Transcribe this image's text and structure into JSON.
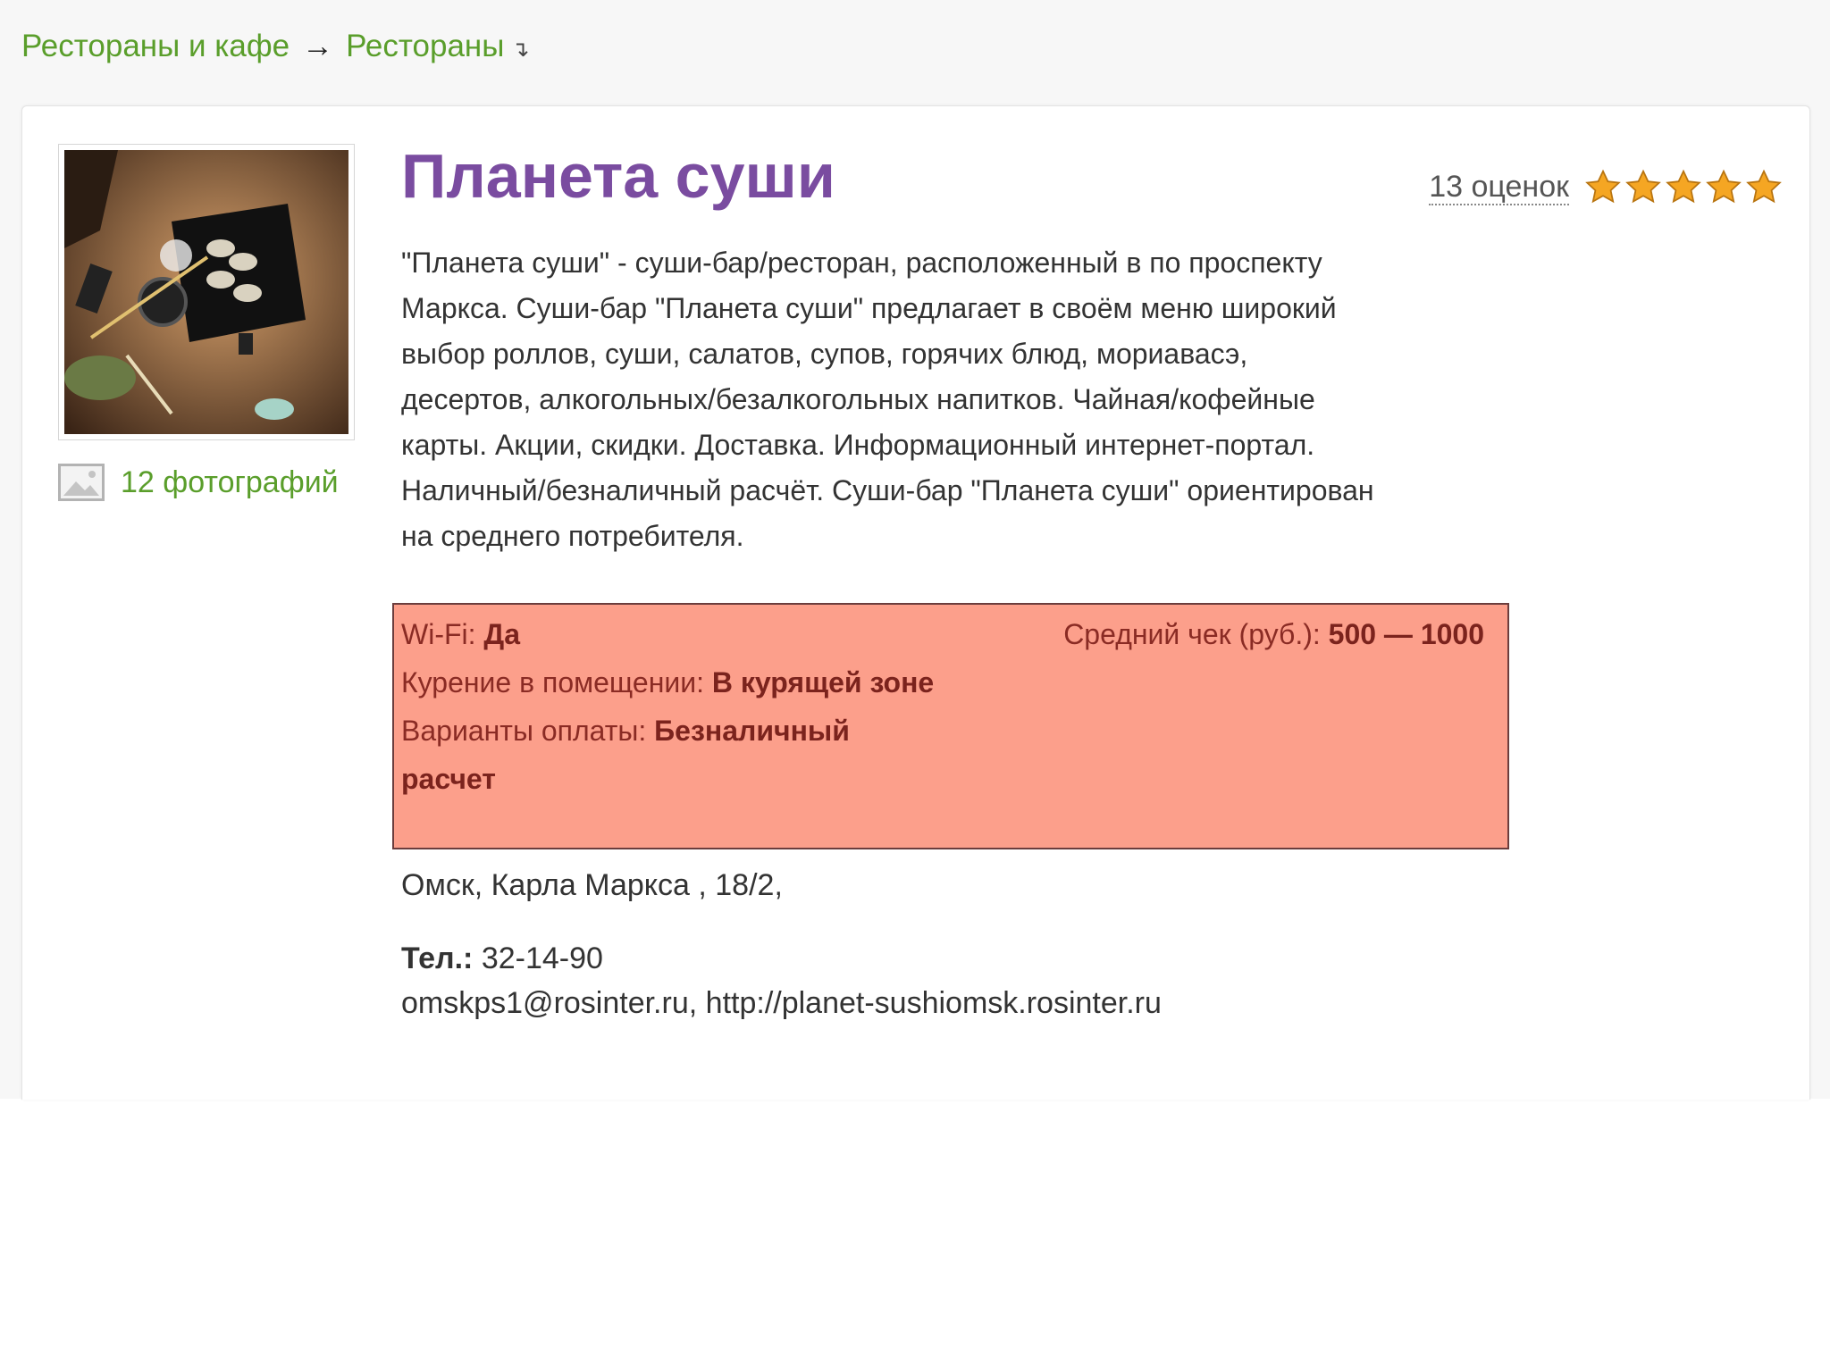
{
  "breadcrumb": {
    "items": [
      "Рестораны и кафе",
      "Рестораны"
    ],
    "separator": "→",
    "dropdown_glyph": "↴"
  },
  "restaurant": {
    "name": "Планета суши",
    "photo_count_label": "12 фотографий",
    "rating_count_label": "13 оценок",
    "stars": 5,
    "description": "\"Планета суши\" - суши-бар/ресторан, расположенный в по проспекту Маркса. Суши-бар \"Планета суши\" предлагает в своём меню широкий выбор роллов, суши, салатов, супов, горячих блюд, мориавасэ, десертов, алкогольных/безалкогольных напитков. Чайная/кофейные карты. Акции, скидки. Доставка. Информационный интернет-портал. Наличный/безналичный расчёт. Суши-бар \"Планета суши\" ориентирован на среднего потребителя."
  },
  "properties": {
    "wifi_label": "Wi-Fi:",
    "wifi_value": "Да",
    "smoking_label": "Курение в помещении:",
    "smoking_value": "В курящей зоне",
    "payment_label": "Варианты оплаты:",
    "payment_value": "Безналичный расчет",
    "avg_check_label": "Средний чек (руб.):",
    "avg_check_value": "500 — 1000"
  },
  "contacts": {
    "address": "Омск, Карла Маркса , 18/2,",
    "phone_label": "Тел.:",
    "phone_value": "32-14-90",
    "email": "omskps1@rosinter.ru",
    "separator": ", ",
    "website": "http://planet-sushiomsk.rosinter.ru"
  },
  "colors": {
    "accent_green": "#5a9e2b",
    "title_purple": "#7a4ca0",
    "highlight_bg": "#fc9f8b",
    "star": "#f5a623"
  },
  "icons": {
    "photo": "image-icon",
    "star": "star-icon"
  }
}
